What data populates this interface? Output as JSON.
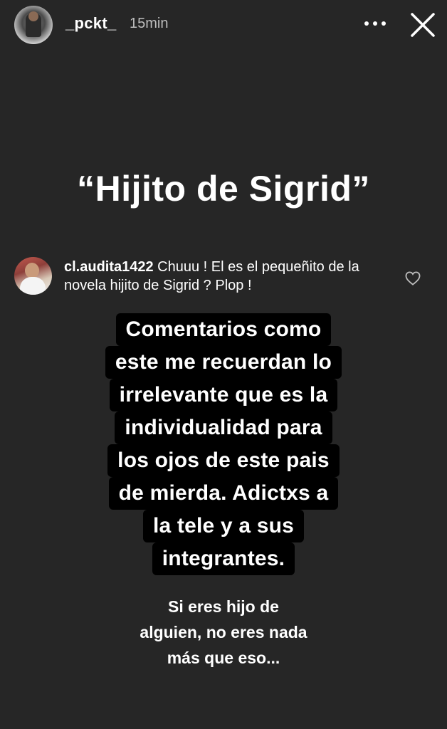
{
  "header": {
    "username": "_pckt_",
    "time_ago": "15min",
    "avatar_icon": "profile-photo",
    "more_icon": "more-dots-icon",
    "close_icon": "close-icon"
  },
  "story": {
    "headline": "“Hijito de Sigrid”",
    "comment": {
      "username": "cl.audita1422",
      "text": " Chuuu ! El es el pequeñito de la novela hijito de Sigrid ? Plop !",
      "like_icon": "heart-outline-icon"
    },
    "highlight_lines": [
      "Comentarios como",
      "este me recuerdan lo",
      "irrelevante que es la",
      "individualidad para",
      "los ojos de este pais",
      "de mierda. Adictxs a",
      "la tele y a sus",
      "integrantes."
    ],
    "footer_lines": [
      "Si eres hijo de",
      "alguien, no eres nada",
      "más que eso..."
    ]
  },
  "colors": {
    "background": "#262626",
    "text": "#ffffff",
    "highlight_bg": "#000000",
    "muted_text": "#bdbdbd"
  }
}
